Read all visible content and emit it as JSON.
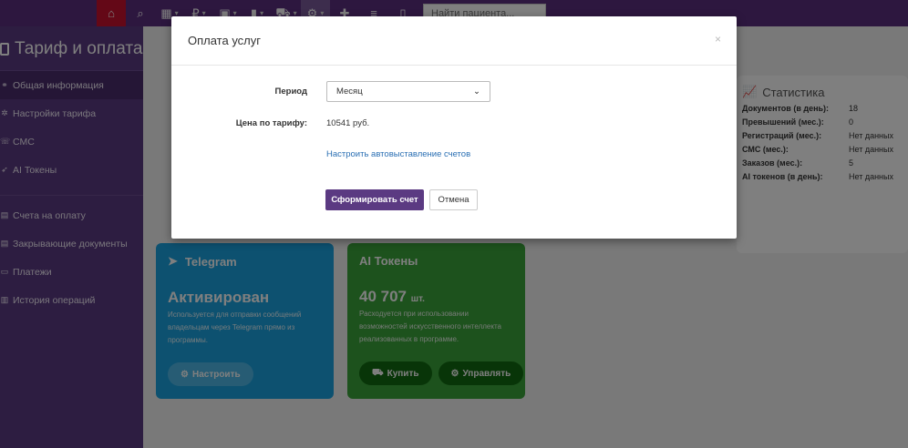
{
  "topbar": {
    "search_placeholder": "Найти пациента..."
  },
  "sidebar": {
    "title": "Тариф и оплата",
    "items": [
      {
        "label": "Общая информация"
      },
      {
        "label": "Настройки тарифа"
      },
      {
        "label": "СМС"
      },
      {
        "label": "AI Токены"
      },
      {
        "label": "Счета на оплату"
      },
      {
        "label": "Закрывающие документы"
      },
      {
        "label": "Платежи"
      },
      {
        "label": "История операций"
      }
    ]
  },
  "stats": {
    "title": "Статистика",
    "rows": [
      {
        "k": "Документов (в день):",
        "v": "18"
      },
      {
        "k": "Превышений (мес.):",
        "v": "0"
      },
      {
        "k": "Регистраций (мес.):",
        "v": "Нет данных"
      },
      {
        "k": "СМС (мес.):",
        "v": "Нет данных"
      },
      {
        "k": "Заказов (мес.):",
        "v": "5"
      },
      {
        "k": "AI токенов (в день):",
        "v": "Нет данных"
      }
    ]
  },
  "telegram_card": {
    "title": "Telegram",
    "status": "Активирован",
    "desc": "Используется для отправки сообщений владельцам через Telegram прямо из программы.",
    "button": "Настроить"
  },
  "ai_card": {
    "title": "AI Токены",
    "amount": "40 707",
    "unit": "шт.",
    "desc": "Расходуется при использовании возможностей искусственного интеллекта реализованных в программе.",
    "buy": "Купить",
    "manage": "Управлять"
  },
  "modal": {
    "title": "Оплата услуг",
    "close": "×",
    "period_label": "Период",
    "period_value": "Месяц",
    "price_label": "Цена по тарифу:",
    "price_value": "10541 руб.",
    "auto_link": "Настроить автовыставление счетов",
    "submit": "Сформировать счет",
    "cancel": "Отмена"
  },
  "colors": {
    "brand": "#5b3a82",
    "home": "#c8102e",
    "telegram": "#1aa3e0",
    "ai": "#3aa43a",
    "link": "#2a6fb3"
  }
}
